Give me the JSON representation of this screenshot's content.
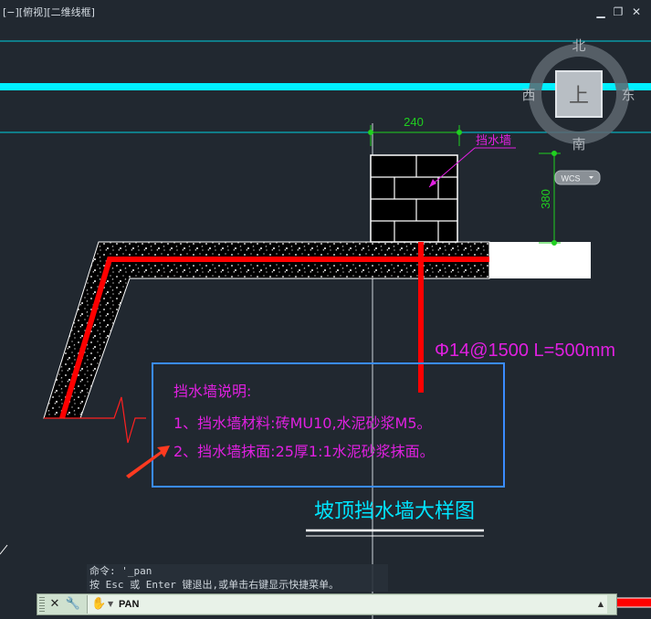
{
  "viewport": {
    "label": "[−][俯视][二维线框]",
    "controls": {
      "minimize": "▁",
      "restore": "❐",
      "close": "✕"
    }
  },
  "viewcube": {
    "north": "北",
    "south": "南",
    "west": "西",
    "east": "东",
    "face": "上",
    "wcs": "WCS"
  },
  "drawing": {
    "dim_width": "240",
    "dim_height": "380",
    "wall_label": "挡水墙",
    "rebar_label": "Φ14@1500 L=500mm",
    "notes_title": "挡水墙说明:",
    "notes_line1": "1、挡水墙材料:砖MU10,水泥砂浆M5。",
    "notes_line2": "2、挡水墙抹面:25厚1:1水泥砂浆抹面。",
    "detail_title": "坡顶挡水墙大样图"
  },
  "command": {
    "history_line1": "命令: '_pan",
    "history_line2": "按 Esc 或 Enter 键退出,或单击右键显示快捷菜单。",
    "current": "PAN",
    "close_icon": "✕",
    "settings_icon": "🔧",
    "hand_icon": "✋",
    "dropdown_icon": "▼",
    "history_up_icon": "▲"
  },
  "colors": {
    "background": "#212830",
    "cyan": "#00e5ff",
    "red": "#ff0000",
    "magenta": "#e020e0",
    "green": "#20d020",
    "blue": "#3a8cff"
  }
}
